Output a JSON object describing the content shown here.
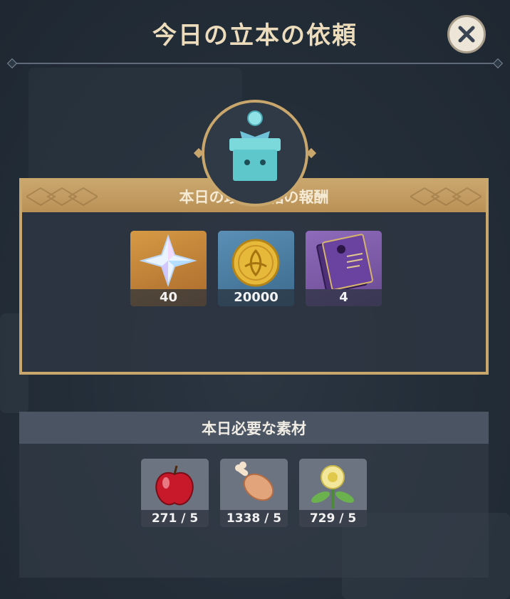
{
  "header": {
    "title": "今日の立本の依頼"
  },
  "close_button": {
    "icon": "close-icon"
  },
  "reward_panel": {
    "title": "本日の珍品の箱の報酬",
    "emblem_icon": "gift-box-icon",
    "items": [
      {
        "icon": "primogem-icon",
        "count": "40"
      },
      {
        "icon": "mora-coin-icon",
        "count": "20000"
      },
      {
        "icon": "heros-wit-book-icon",
        "count": "4"
      }
    ]
  },
  "materials_panel": {
    "title": "本日必要な素材",
    "items": [
      {
        "icon": "apple-icon",
        "count": "271 / 5"
      },
      {
        "icon": "raw-meat-icon",
        "count": "1338 / 5"
      },
      {
        "icon": "sweet-flower-icon",
        "count": "729 / 5"
      }
    ]
  },
  "colors": {
    "accent_gold": "#c9a66b",
    "title_text": "#ecdcbb",
    "panel_bg": "#2c3541"
  }
}
